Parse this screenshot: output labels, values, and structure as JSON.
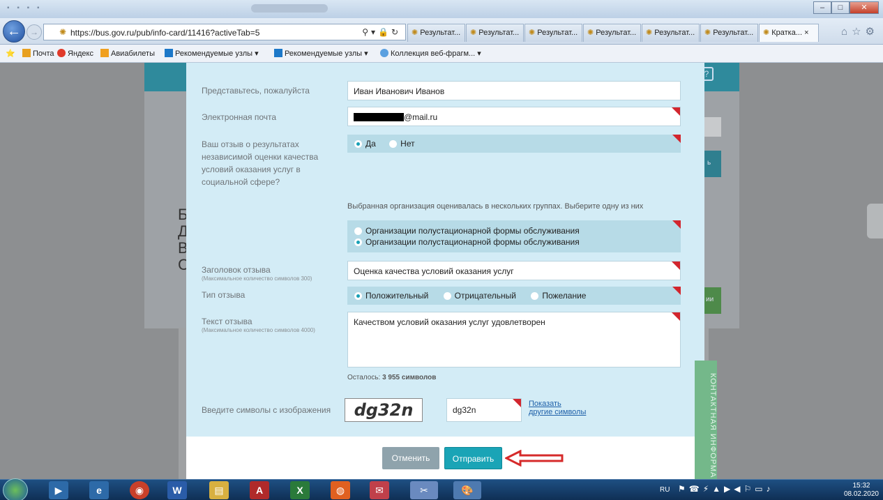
{
  "browser": {
    "url": "https://bus.gov.ru/pub/info-card/11416?activeTab=5",
    "tabs": [
      {
        "label": "Результат...",
        "active": false
      },
      {
        "label": "Результат...",
        "active": false
      },
      {
        "label": "Результат...",
        "active": false
      },
      {
        "label": "Результат...",
        "active": false
      },
      {
        "label": "Результат...",
        "active": false
      },
      {
        "label": "Результат...",
        "active": false
      },
      {
        "label": "Кратка...",
        "active": true
      }
    ],
    "close_tab": "×"
  },
  "favorites": {
    "items": [
      "Почта",
      "Яндекс",
      "Авиабилеты",
      "Рекомендуемые узлы ▾",
      "Рекомендуемые узлы ▾",
      "Коллекция веб-фрагм... ▾"
    ]
  },
  "form": {
    "name_label": "Представьтесь, пожалуйста",
    "name_value": "Иван Иванович Иванов",
    "email_label": "Электронная почта",
    "email_value": "@mail.ru",
    "feedback_question": "Ваш отзыв о результатах независимой оценки качества условий оказания услуг в социальной сфере?",
    "feedback_options": [
      "Да",
      "Нет"
    ],
    "feedback_selected": "Да",
    "group_hint": "Выбранная организация оценивалась в нескольких группах. Выберите одну из них",
    "group_options": [
      "Организации полустационарной формы обслуживания",
      "Организации полустационарной формы обслуживания"
    ],
    "title_label": "Заголовок отзыва",
    "title_sub": "(Максимальное количество символов 300)",
    "title_value": "Оценка качества условий оказания услуг",
    "type_label": "Тип отзыва",
    "type_options": [
      "Положительный",
      "Отрицательный",
      "Пожелание"
    ],
    "text_label": "Текст отзыва",
    "text_sub": "(Максимальное количество символов 4000)",
    "text_value": "Качеством условий оказания услуг удовлетворен",
    "remaining_prefix": "Осталось:",
    "remaining_value": "3 955 символов",
    "captcha_label": "Введите символы с изображения",
    "captcha_image_text": "dg32n",
    "captcha_value": "dg32n",
    "captcha_refresh_line1": "Показать",
    "captcha_refresh_line2": "другие символы",
    "cancel_label": "Отменить",
    "submit_label": "Отправить",
    "side_tab": "КОНТАКТНАЯ ИНФОРМА"
  },
  "background": {
    "letters": [
      "Б",
      "Д",
      "В",
      "С"
    ],
    "fragment_1": "ь",
    "fragment_2": "ии"
  },
  "taskbar": {
    "lang": "RU",
    "time": "15:32",
    "date": "08.02.2020"
  },
  "colors": {
    "accent": "#1aa4b6",
    "modal_bg": "#d3ecf6",
    "required_flag": "#d2262e",
    "annotation_arrow": "#d62a2a"
  }
}
